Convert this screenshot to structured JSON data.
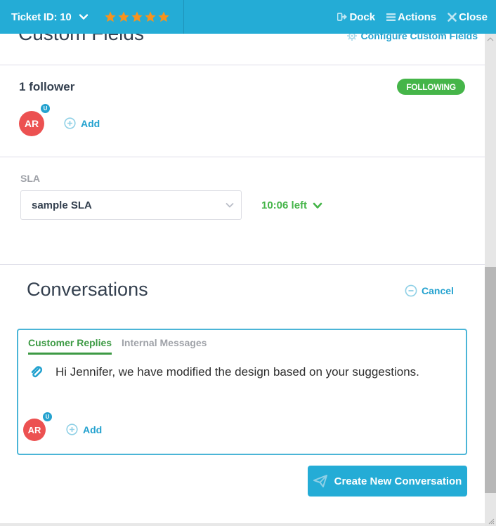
{
  "header": {
    "ticket_label": "Ticket ID: 10",
    "rating": 5,
    "rating_max": 5,
    "actions": [
      {
        "label": "Dock",
        "icon": "dock-icon"
      },
      {
        "label": "Actions",
        "icon": "menu-icon"
      },
      {
        "label": "Close",
        "icon": "close-icon"
      }
    ]
  },
  "custom_fields": {
    "title": "Custom Fields",
    "configure_label": "Configure Custom Fields"
  },
  "followers": {
    "title": "1 follower",
    "status_badge": "FOLLOWING",
    "avatar_initials": "AR",
    "avatar_badge": "U",
    "add_label": "Add"
  },
  "sla": {
    "label": "SLA",
    "selected": "sample SLA",
    "time_left": "10:06 left"
  },
  "conversations": {
    "title": "Conversations",
    "cancel_label": "Cancel",
    "tabs": [
      {
        "label": "Customer Replies",
        "active": true
      },
      {
        "label": "Internal Messages",
        "active": false
      }
    ],
    "message": "Hi Jennifer, we have modified the design based on your suggestions.",
    "avatar_initials": "AR",
    "avatar_badge": "U",
    "add_label": "Add",
    "create_button": "Create New Conversation"
  },
  "colors": {
    "brand": "#24acd6",
    "success": "#45b549",
    "star": "#f7931e",
    "avatar": "#ec5151"
  }
}
